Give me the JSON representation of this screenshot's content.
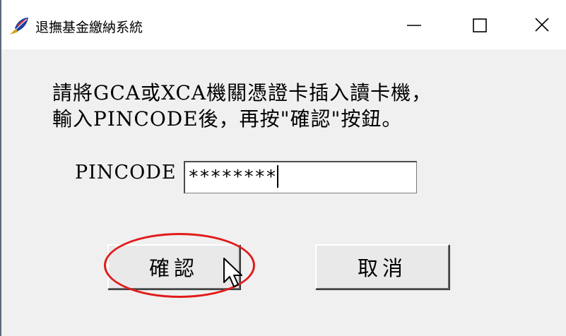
{
  "window": {
    "title": "退撫基金繳納系統",
    "controls": {
      "minimize": "—",
      "maximize": "☐",
      "close": "✕"
    }
  },
  "instruction": {
    "line1": "請將GCA或XCA機關憑證卡插入讀卡機，",
    "line2": "輸入PINCODE後，再按\"確認\"按鈕。"
  },
  "pin": {
    "label": "PINCODE",
    "value": "********"
  },
  "buttons": {
    "confirm": "確認",
    "cancel": "取消"
  },
  "colors": {
    "highlight": "#e11b1b",
    "dialog_bg": "#f0f0f0"
  },
  "icons": {
    "app": "pen-feather-icon",
    "cursor": "mouse-pointer-icon"
  }
}
